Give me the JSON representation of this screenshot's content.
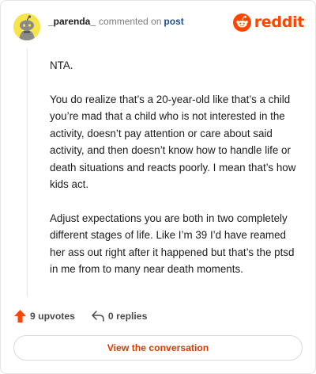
{
  "header": {
    "username": "_parenda_",
    "commented_text": "commented on",
    "post_link": "post",
    "brand": "reddit"
  },
  "comment": {
    "paragraphs": [
      "NTA.",
      "You do realize that’s a 20-year-old like that’s a child you’re mad that a child who is not interested in the activity, doesn’t pay attention or care about said activity, and then doesn’t know how to handle life or death situations and reacts poorly. I mean that’s how kids act.",
      "Adjust expectations you are both in two completely different stages of life. Like I’m 39 I’d have reamed her ass out right after it happened but that’s the ptsd in me from to many near death moments."
    ]
  },
  "actions": {
    "upvotes": "9 upvotes",
    "replies": "0 replies"
  },
  "cta": {
    "label": "View the conversation"
  },
  "colors": {
    "brand": "#ff4500",
    "upvote": "#ff4500",
    "link": "#1a4f8a",
    "cta_text": "#d93a00",
    "avatar_bg": "#f7e34a"
  },
  "icons": {
    "avatar": "snoo-avatar",
    "brand": "reddit-snoo-logo",
    "upvote": "upvote-arrow-icon",
    "reply": "reply-arrow-icon"
  }
}
